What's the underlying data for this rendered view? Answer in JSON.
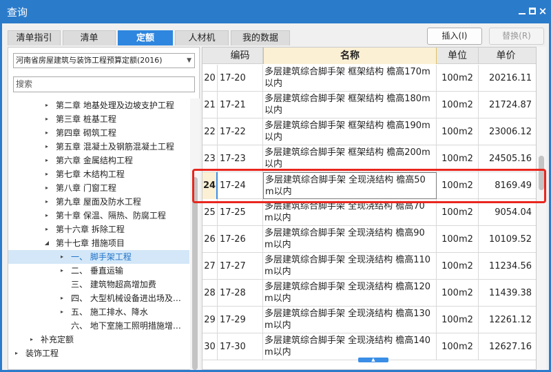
{
  "window": {
    "title": "查询",
    "min_icon": "minimize-icon",
    "max_icon": "maximize-icon",
    "close_icon": "×"
  },
  "tabs": [
    {
      "label": "清单指引",
      "active": false
    },
    {
      "label": "清单",
      "active": false
    },
    {
      "label": "定额",
      "active": true
    },
    {
      "label": "人材机",
      "active": false
    },
    {
      "label": "我的数据",
      "active": false
    }
  ],
  "toolbar": {
    "insert_label": "插入(I)",
    "replace_label": "替换(R)"
  },
  "left": {
    "quota_select": "河南省房屋建筑与装饰工程预算定额(2016)",
    "search_placeholder": "搜索",
    "tree": [
      {
        "label": "第二章  地基处理及边坡支护工程",
        "arrow": "▸"
      },
      {
        "label": "第三章  桩基工程",
        "arrow": "▸"
      },
      {
        "label": "第四章  砌筑工程",
        "arrow": "▸"
      },
      {
        "label": "第五章  混凝土及钢筋混凝土工程",
        "arrow": "▸"
      },
      {
        "label": "第六章  金属结构工程",
        "arrow": "▸"
      },
      {
        "label": "第七章  木结构工程",
        "arrow": "▸"
      },
      {
        "label": "第八章  门窗工程",
        "arrow": "▸"
      },
      {
        "label": "第九章  屋面及防水工程",
        "arrow": "▸"
      },
      {
        "label": "第十章  保温、隔热、防腐工程",
        "arrow": "▸"
      },
      {
        "label": "第十六章  拆除工程",
        "arrow": "▸"
      },
      {
        "label": "第十七章  措施项目",
        "arrow": "◢"
      },
      {
        "label": "一、 脚手架工程",
        "arrow": "▸",
        "selected": true
      },
      {
        "label": "二、 垂直运输",
        "arrow": "▸"
      },
      {
        "label": "三、 建筑物超高增加费",
        "arrow": ""
      },
      {
        "label": "四、 大型机械设备进出场及…",
        "arrow": "▸"
      },
      {
        "label": "五、 施工排水、降水",
        "arrow": "▸"
      },
      {
        "label": "六、 地下室施工照明措施增…",
        "arrow": ""
      },
      {
        "label": "补充定额",
        "arrow": "▸"
      },
      {
        "label": "装饰工程",
        "arrow": "▸"
      }
    ]
  },
  "grid": {
    "headers": [
      "编码",
      "名称",
      "单位",
      "单价"
    ],
    "rows": [
      {
        "idx": "20",
        "code": "17-20",
        "name": "多层建筑综合脚手架  框架结构  檐高170m以内",
        "unit": "100m2",
        "price": "20216.11"
      },
      {
        "idx": "21",
        "code": "17-21",
        "name": "多层建筑综合脚手架  框架结构  檐高180m以内",
        "unit": "100m2",
        "price": "21724.87"
      },
      {
        "idx": "22",
        "code": "17-22",
        "name": "多层建筑综合脚手架  框架结构  檐高190m以内",
        "unit": "100m2",
        "price": "23006.12"
      },
      {
        "idx": "23",
        "code": "17-23",
        "name": "多层建筑综合脚手架  框架结构  檐高200m以内",
        "unit": "100m2",
        "price": "24505.16"
      },
      {
        "idx": "24",
        "code": "17-24",
        "name": "多层建筑综合脚手架  全现浇结构  檐高50m以内",
        "unit": "100m2",
        "price": "8169.49",
        "selected": true
      },
      {
        "idx": "25",
        "code": "17-25",
        "name": "多层建筑综合脚手架  全现浇结构  檐高70m以内",
        "unit": "100m2",
        "price": "9054.04"
      },
      {
        "idx": "26",
        "code": "17-26",
        "name": "多层建筑综合脚手架  全现浇结构  檐高90m以内",
        "unit": "100m2",
        "price": "10109.52"
      },
      {
        "idx": "27",
        "code": "17-27",
        "name": "多层建筑综合脚手架  全现浇结构  檐高110m以内",
        "unit": "100m2",
        "price": "11234.56"
      },
      {
        "idx": "28",
        "code": "17-28",
        "name": "多层建筑综合脚手架  全现浇结构  檐高120m以内",
        "unit": "100m2",
        "price": "11439.38"
      },
      {
        "idx": "29",
        "code": "17-29",
        "name": "多层建筑综合脚手架  全现浇结构  檐高130m以内",
        "unit": "100m2",
        "price": "12261.12"
      },
      {
        "idx": "30",
        "code": "17-30",
        "name": "多层建筑综合脚手架  全现浇结构  檐高140m以内",
        "unit": "100m2",
        "price": "12627.16"
      }
    ]
  },
  "colors": {
    "titlebar": "#2b7bcb",
    "tab_active": "#2e86de",
    "highlight_box": "#e8261e",
    "name_header": "#fbf0d3"
  }
}
